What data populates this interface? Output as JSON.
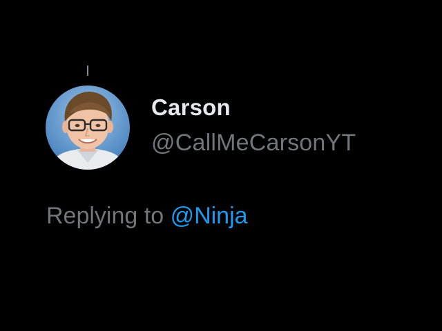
{
  "tweet": {
    "author": {
      "display_name": "Carson",
      "handle": "@CallMeCarsonYT",
      "avatar_icon": "profile-photo"
    },
    "reply": {
      "prefix": "Replying to",
      "target_handle": "@Ninja"
    }
  },
  "colors": {
    "background": "#000000",
    "name": "#e7e9ea",
    "secondary_text": "#71767b",
    "link": "#1d9bf0",
    "thread_line": "#8b8f93"
  }
}
